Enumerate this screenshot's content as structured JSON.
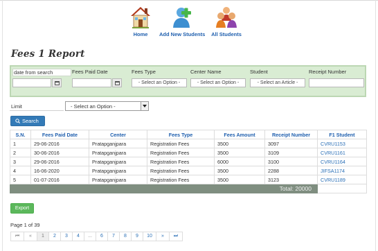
{
  "nav": {
    "home_label": "Home",
    "add_label": "Add New Students",
    "all_label": "All Students"
  },
  "page_title": "Fees 1 Report",
  "filters": {
    "date_from_label": "date from search",
    "fees_paid_date_label": "Fees Paid Date",
    "fees_type_label": "Fees Type",
    "center_name_label": "Center Name",
    "student_label": "Student",
    "receipt_number_label": "Receipt Number",
    "fees_type_value": "- Select an Option -",
    "center_value": "- Select an Option -",
    "student_value": "- Select an Article -"
  },
  "limit": {
    "label": "Limit",
    "value": "- Select an Option -"
  },
  "search_label": "Search",
  "table": {
    "headers": [
      "S.N.",
      "Fees Paid Date",
      "Center",
      "Fees Type",
      "Fees Amount",
      "Receipt Number",
      "F1 Student"
    ],
    "rows": [
      [
        "1",
        "29-06-2016",
        "Pratapganjpara",
        "Registration Fees",
        "3500",
        "3097",
        "CVRU1153"
      ],
      [
        "2",
        "30-06-2016",
        "Pratapganjpara",
        "Registration Fees",
        "3500",
        "3109",
        "CVRU1161"
      ],
      [
        "3",
        "29-06-2016",
        "Pratapganjpara",
        "Registration Fees",
        "6000",
        "3100",
        "CVRU1164"
      ],
      [
        "4",
        "16-06-2020",
        "Pratapganjpara",
        "Registration Fees",
        "3500",
        "2288",
        "JIFSA1174"
      ],
      [
        "5",
        "01-07-2016",
        "Pratapganjpara",
        "Registration Fees",
        "3500",
        "3123",
        "CVRU1189"
      ]
    ],
    "total": "Total:  20000"
  },
  "export_label": "Export",
  "page_info": "Page 1 of 39",
  "pagination": [
    "⏮",
    "«",
    "1",
    "2",
    "3",
    "4",
    "...",
    "6",
    "7",
    "8",
    "9",
    "10",
    "»",
    "⏭"
  ],
  "colors": {
    "link_blue": "#2a6fb6",
    "search_button": "#337ab7",
    "export_button": "#5cb85c",
    "filter_panel": "#d9ecd3",
    "total_row": "#7f8e80"
  },
  "icons": {
    "home": "home-icon",
    "add_student": "add-student-icon",
    "all_students": "group-icon",
    "calendar": "calendar-icon",
    "search": "search-icon"
  }
}
